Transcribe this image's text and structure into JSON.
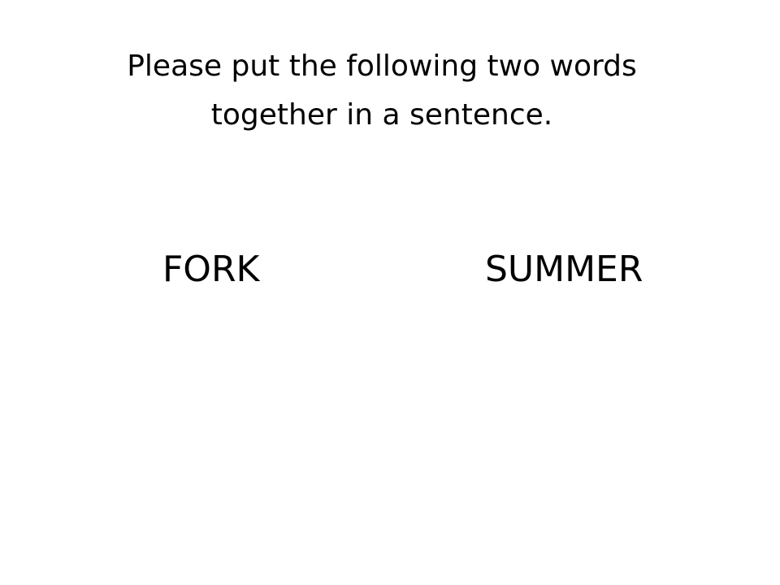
{
  "slide": {
    "instruction_lines": [
      "Please put the following two words",
      "together in a sentence."
    ],
    "words": [
      "FORK",
      "SUMMER"
    ]
  },
  "colors": {
    "background": "#ffffff",
    "text": "#000000"
  }
}
